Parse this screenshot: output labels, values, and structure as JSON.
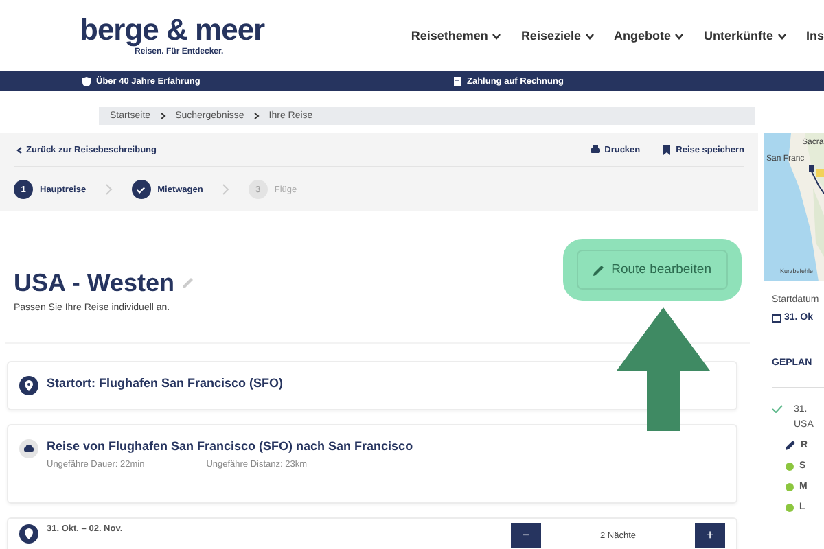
{
  "logo": {
    "name": "berge & meer",
    "tagline": "Reisen. Für Entdecker."
  },
  "nav": [
    {
      "label": "Reisethemen",
      "dropdown": true
    },
    {
      "label": "Reiseziele",
      "dropdown": true
    },
    {
      "label": "Angebote",
      "dropdown": true
    },
    {
      "label": "Unterkünfte",
      "dropdown": true
    },
    {
      "label": "Ins",
      "dropdown": false
    }
  ],
  "info_bar": [
    {
      "kind": "shield",
      "text": "Über 40 Jahre Erfahrung"
    },
    {
      "kind": "invoice",
      "text": "Zahlung auf Rechnung"
    }
  ],
  "breadcrumb": [
    "Startseite",
    "Suchergebnisse",
    "Ihre Reise"
  ],
  "toolbar": {
    "back": "Zurück zur Reisebeschreibung",
    "print": "Drucken",
    "save": "Reise speichern"
  },
  "steps": [
    {
      "number": "1",
      "label": "Hauptreise",
      "done": false,
      "disabled": false
    },
    {
      "label": "Mietwagen",
      "done": true,
      "disabled": false
    },
    {
      "number": "3",
      "label": "Flüge",
      "done": false,
      "disabled": true
    }
  ],
  "trip": {
    "title": "USA - Westen",
    "subtitle": "Passen Sie Ihre Reise individuell an.",
    "edit_button": "Route bearbeiten",
    "highlighted": true
  },
  "cards": [
    {
      "kind": "start",
      "title": "Startort: Flughafen San Francisco (SFO)"
    },
    {
      "kind": "drive",
      "title": "Reise von Flughafen San Francisco (SFO) nach San Francisco",
      "duration": "Ungefähre Dauer: 22min",
      "distance": "Ungefähre Distanz: 23km"
    },
    {
      "kind": "stay",
      "dates": "31. Okt. – 02. Nov.",
      "nights": "2 Nächte",
      "minus": "−",
      "plus": "+"
    }
  ],
  "side": {
    "map_labels": [
      "Sacra",
      "San Franc"
    ],
    "map_credit": "Kurzbefehle",
    "start_label": "Startdatum",
    "start_date": "31. Ok",
    "planned": "GEPLAN",
    "entry": {
      "date": "31.",
      "place": "USA"
    },
    "items": [
      {
        "kind": "edit",
        "text": "R"
      },
      {
        "kind": "dot",
        "text": "S"
      },
      {
        "kind": "dot",
        "text": "M"
      },
      {
        "kind": "dot",
        "text": "L"
      }
    ]
  }
}
